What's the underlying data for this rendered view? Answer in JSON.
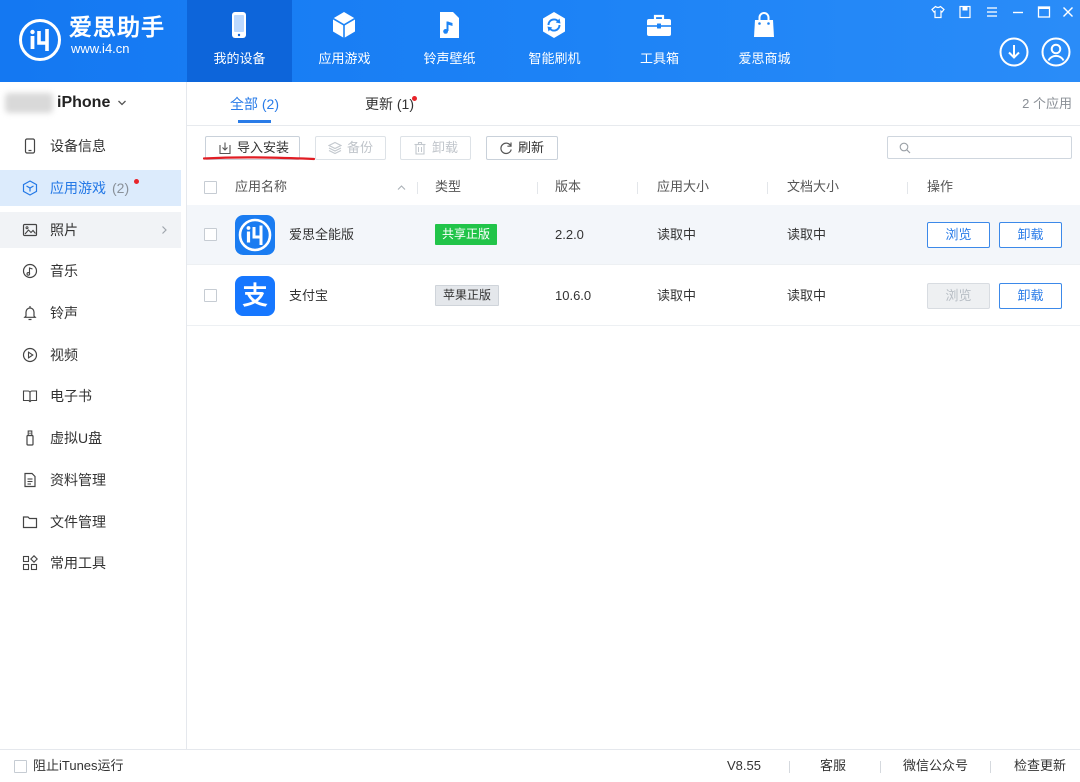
{
  "app": {
    "title": "爱思助手",
    "website": "www.i4.cn"
  },
  "header": {
    "nav_tabs": [
      {
        "label": "我的设备",
        "icon": "phone-icon",
        "selected": true
      },
      {
        "label": "应用游戏",
        "icon": "cube-icon",
        "selected": false
      },
      {
        "label": "铃声壁纸",
        "icon": "music-file-icon",
        "selected": false
      },
      {
        "label": "智能刷机",
        "icon": "flash-refresh-icon",
        "selected": false
      },
      {
        "label": "工具箱",
        "icon": "toolbox-icon",
        "selected": false
      },
      {
        "label": "爱思商城",
        "icon": "shopping-bag-icon",
        "selected": false
      }
    ],
    "window_controls": [
      "skin-icon",
      "feedback-icon",
      "menu-icon",
      "minimize-icon",
      "maximize-icon",
      "close-icon"
    ],
    "actions": [
      "download-icon",
      "user-icon"
    ]
  },
  "sidebar": {
    "device_name": "iPhone",
    "items": [
      {
        "label": "设备信息",
        "icon": "phone-outline-icon"
      },
      {
        "label": "应用游戏",
        "count": "(2)",
        "icon": "cube-outline-icon",
        "selected": true,
        "notification_dot": true
      },
      {
        "label": "照片",
        "icon": "picture-icon",
        "hovered": true,
        "has_submenu": true
      },
      {
        "label": "音乐",
        "icon": "music-icon"
      },
      {
        "label": "铃声",
        "icon": "bell-icon"
      },
      {
        "label": "视频",
        "icon": "video-icon"
      },
      {
        "label": "电子书",
        "icon": "ebook-icon"
      },
      {
        "label": "虚拟U盘",
        "icon": "usb-drive-icon"
      },
      {
        "label": "资料管理",
        "icon": "document-list-icon"
      },
      {
        "label": "文件管理",
        "icon": "folder-icon"
      },
      {
        "label": "常用工具",
        "icon": "tools-grid-icon"
      }
    ]
  },
  "main": {
    "tabs": [
      {
        "label": "全部 (2)",
        "selected": true
      },
      {
        "label": "更新 (1)",
        "selected": false,
        "notification_dot": true
      }
    ],
    "app_count": "2 个应用",
    "toolbar": {
      "import_label": "导入安装",
      "backup_label": "备份",
      "uninstall_label": "卸载",
      "refresh_label": "刷新",
      "backup_disabled": true,
      "uninstall_disabled": true
    },
    "table": {
      "columns": [
        "应用名称",
        "类型",
        "版本",
        "应用大小",
        "文档大小",
        "操作"
      ],
      "rows": [
        {
          "name": "爱思全能版",
          "icon": "i4-app-icon",
          "type": "共享正版",
          "version": "2.2.0",
          "app_size": "读取中",
          "doc_size": "读取中",
          "browse_label": "浏览",
          "browse_disabled": false,
          "uninstall_label": "卸载",
          "checked": false
        },
        {
          "name": "支付宝",
          "icon": "alipay-app-icon",
          "icon_glyph": "支",
          "type": "苹果正版",
          "version": "10.6.0",
          "app_size": "读取中",
          "doc_size": "读取中",
          "browse_label": "浏览",
          "browse_disabled": true,
          "uninstall_label": "卸载",
          "checked": false
        }
      ]
    }
  },
  "status_bar": {
    "block_itunes_label": "阻止iTunes运行",
    "block_itunes_checked": false,
    "version": "V8.55",
    "support": "客服",
    "wechat": "微信公众号",
    "check_update": "检查更新"
  },
  "colors": {
    "header_blue": "#1a7ff5",
    "selected_tab_blue": "#0d65da",
    "accent": "#2a7ce8",
    "sidebar_selected_bg": "#dcebfc",
    "badge_green": "#21c449",
    "notification_red": "#e8242a",
    "annotation_red": "#e11d24"
  }
}
